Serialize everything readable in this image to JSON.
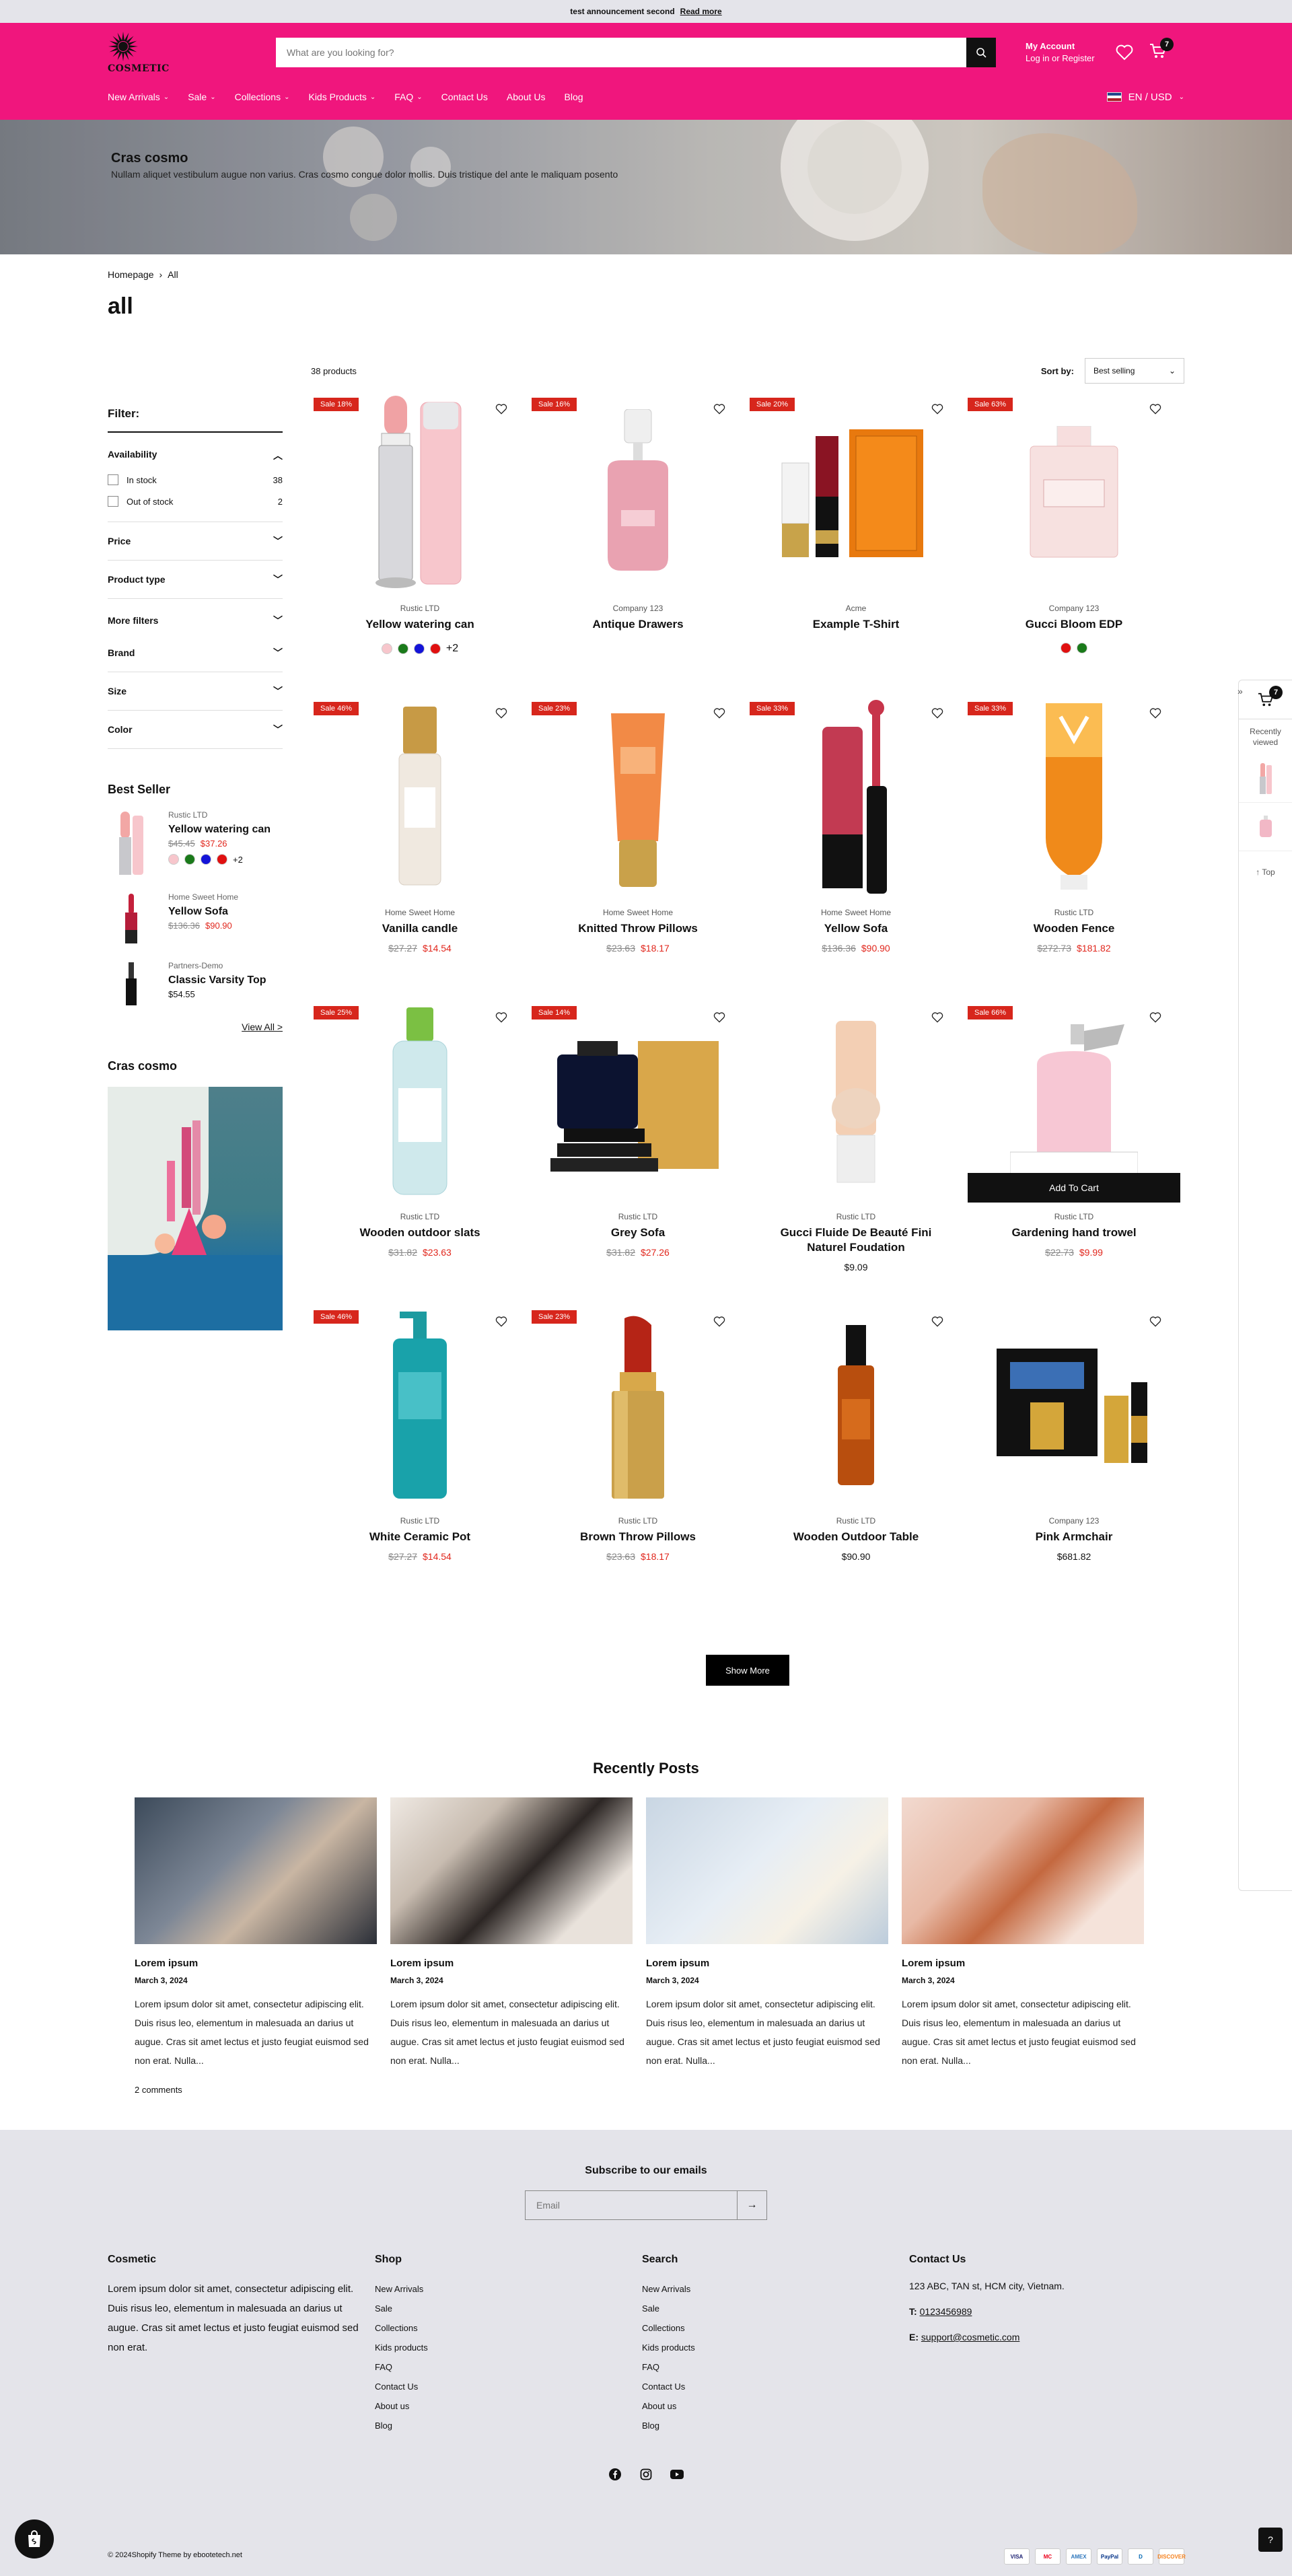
{
  "announcement": {
    "text": "test announcement second",
    "link": "Read more"
  },
  "header": {
    "logo": "COSMETIC",
    "search_placeholder": "What are you looking for?",
    "account_title": "My Account",
    "account_sub": "Log in or Register",
    "cart_count": "7",
    "nav": [
      {
        "label": "New Arrivals",
        "dropdown": true
      },
      {
        "label": "Sale",
        "dropdown": true
      },
      {
        "label": "Collections",
        "dropdown": true
      },
      {
        "label": "Kids Products",
        "dropdown": true
      },
      {
        "label": "FAQ",
        "dropdown": true
      },
      {
        "label": "Contact Us",
        "dropdown": false
      },
      {
        "label": "About Us",
        "dropdown": false
      },
      {
        "label": "Blog",
        "dropdown": false
      }
    ],
    "locale": "EN / USD"
  },
  "hero": {
    "title": "Cras cosmo",
    "text": "Nullam aliquet vestibulum augue non varius. Cras cosmo congue dolor mollis. Duis tristique del ante le maliquam posento"
  },
  "breadcrumb": {
    "home": "Homepage",
    "current": "All"
  },
  "page_title": "all",
  "filters": {
    "title": "Filter:",
    "availability": "Availability",
    "in_stock": "In stock",
    "in_stock_count": "38",
    "out_stock": "Out of stock",
    "out_stock_count": "2",
    "groups": [
      "Price",
      "Product type",
      "More filters",
      "Brand",
      "Size",
      "Color"
    ]
  },
  "best_seller": {
    "title": "Best Seller",
    "items": [
      {
        "vendor": "Rustic LTD",
        "name": "Yellow watering can",
        "old": "$45.45",
        "price": "$37.26",
        "more": "+2"
      },
      {
        "vendor": "Home Sweet Home",
        "name": "Yellow Sofa",
        "old": "$136.36",
        "price": "$90.90"
      },
      {
        "vendor": "Partners-Demo",
        "name": "Classic Varsity Top",
        "price": "$54.55"
      }
    ],
    "view_all": "View All >"
  },
  "cras_sidebar_title": "Cras cosmo",
  "toolbar": {
    "count": "38 products",
    "sort_label": "Sort by:",
    "sort_value": "Best selling"
  },
  "products": [
    {
      "sale": "Sale 18%",
      "vendor": "Rustic LTD",
      "name": "Yellow watering can",
      "swatches": [
        "#f7c6cc",
        "#1a7a1a",
        "#1414d8",
        "#e01010"
      ],
      "more": "+2",
      "img": "lipbalm"
    },
    {
      "sale": "Sale 16%",
      "vendor": "Company 123",
      "name": "Antique Drawers",
      "img": "perfume_pink"
    },
    {
      "sale": "Sale 20%",
      "vendor": "Acme",
      "name": "Example T-Shirt",
      "img": "lipstick_box"
    },
    {
      "sale": "Sale 63%",
      "vendor": "Company 123",
      "name": "Gucci Bloom EDP",
      "swatches": [
        "#e01010",
        "#1a7a1a"
      ],
      "img": "gucci"
    },
    {
      "sale": "Sale 46%",
      "vendor": "Home Sweet Home",
      "name": "Vanilla candle",
      "old": "$27.27",
      "price": "$14.54",
      "img": "serum"
    },
    {
      "sale": "Sale 23%",
      "vendor": "Home Sweet Home",
      "name": "Knitted Throw Pillows",
      "old": "$23.63",
      "price": "$18.17",
      "img": "lotion"
    },
    {
      "sale": "Sale 33%",
      "vendor": "Home Sweet Home",
      "name": "Yellow Sofa",
      "old": "$136.36",
      "price": "$90.90",
      "img": "lipgloss"
    },
    {
      "sale": "Sale 33%",
      "vendor": "Rustic LTD",
      "name": "Wooden Fence",
      "old": "$272.73",
      "price": "$181.82",
      "img": "vichy"
    },
    {
      "sale": "Sale 25%",
      "vendor": "Rustic LTD",
      "name": "Wooden outdoor slats",
      "old": "$31.82",
      "price": "$23.63",
      "img": "bioderma"
    },
    {
      "sale": "Sale 14%",
      "vendor": "Rustic LTD",
      "name": "Grey Sofa",
      "old": "$31.82",
      "price": "$27.26",
      "img": "bleu"
    },
    {
      "vendor": "Rustic LTD",
      "name": "Gucci Fluide De Beauté Fini Naturel Foudation",
      "price": "$9.09",
      "img": "foundation"
    },
    {
      "sale": "Sale 66%",
      "vendor": "Rustic LTD",
      "name": "Gardening hand trowel",
      "old": "$22.73",
      "price": "$9.99",
      "img": "lancome",
      "addcart": "Add To Cart"
    },
    {
      "sale": "Sale 46%",
      "vendor": "Rustic LTD",
      "name": "White Ceramic Pot",
      "old": "$27.27",
      "price": "$14.54",
      "img": "avene"
    },
    {
      "sale": "Sale 23%",
      "vendor": "Rustic LTD",
      "name": "Brown Throw Pillows",
      "old": "$23.63",
      "price": "$18.17",
      "img": "redlipstick"
    },
    {
      "vendor": "Rustic LTD",
      "name": "Wooden Outdoor Table",
      "price": "$90.90",
      "img": "oil"
    },
    {
      "vendor": "Company 123",
      "name": "Pink Armchair",
      "price": "$681.82",
      "img": "scandal"
    }
  ],
  "show_more": "Show More",
  "posts": {
    "title": "Recently Posts",
    "items": [
      {
        "title": "Lorem ipsum",
        "date": "March 3, 2024",
        "text": "Lorem ipsum dolor sit amet, consectetur adipiscing elit. Duis risus leo, elementum in malesuada an darius ut augue. Cras sit amet lectus et justo feugiat euismod sed non erat. Nulla...",
        "comments": "2 comments"
      },
      {
        "title": "Lorem ipsum",
        "date": "March 3, 2024",
        "text": "Lorem ipsum dolor sit amet, consectetur adipiscing elit. Duis risus leo, elementum in malesuada an darius ut augue. Cras sit amet lectus et justo feugiat euismod sed non erat. Nulla..."
      },
      {
        "title": "Lorem ipsum",
        "date": "March 3, 2024",
        "text": "Lorem ipsum dolor sit amet, consectetur adipiscing elit. Duis risus leo, elementum in malesuada an darius ut augue. Cras sit amet lectus et justo feugiat euismod sed non erat. Nulla..."
      },
      {
        "title": "Lorem ipsum",
        "date": "March 3, 2024",
        "text": "Lorem ipsum dolor sit amet, consectetur adipiscing elit. Duis risus leo, elementum in malesuada an darius ut augue. Cras sit amet lectus et justo feugiat euismod sed non erat. Nulla..."
      }
    ]
  },
  "footer": {
    "subscribe_title": "Subscribe to our emails",
    "email_placeholder": "Email",
    "about_title": "Cosmetic",
    "about_text": "Lorem ipsum dolor sit amet, consectetur adipiscing elit. Duis risus leo, elementum in malesuada an darius ut augue. Cras sit amet lectus et justo feugiat euismod sed non erat.",
    "shop_title": "Shop",
    "shop_links": [
      "New Arrivals",
      "Sale",
      "Collections",
      "Kids products",
      "FAQ",
      "Contact Us",
      "About us",
      "Blog"
    ],
    "search_title": "Search",
    "search_links": [
      "New Arrivals",
      "Sale",
      "Collections",
      "Kids products",
      "FAQ",
      "Contact Us",
      "About us",
      "Blog"
    ],
    "contact_title": "Contact Us",
    "address": "123 ABC, TAN st, HCM city, Vietnam.",
    "phone_label": "T:",
    "phone": "0123456989",
    "email_label": "E:",
    "email": "support@cosmetic.com",
    "copyright": "© 2024Shopify Theme by ebootetech.net",
    "payments": [
      "VISA",
      "MC",
      "AMEX",
      "PayPal",
      "D",
      "DISCOVER"
    ]
  },
  "widget": {
    "cart_count": "7",
    "recently": "Recently viewed",
    "top": "Top"
  },
  "colors": {
    "brand": "#f0167d",
    "sale": "#d7261c",
    "dark": "#111111"
  }
}
